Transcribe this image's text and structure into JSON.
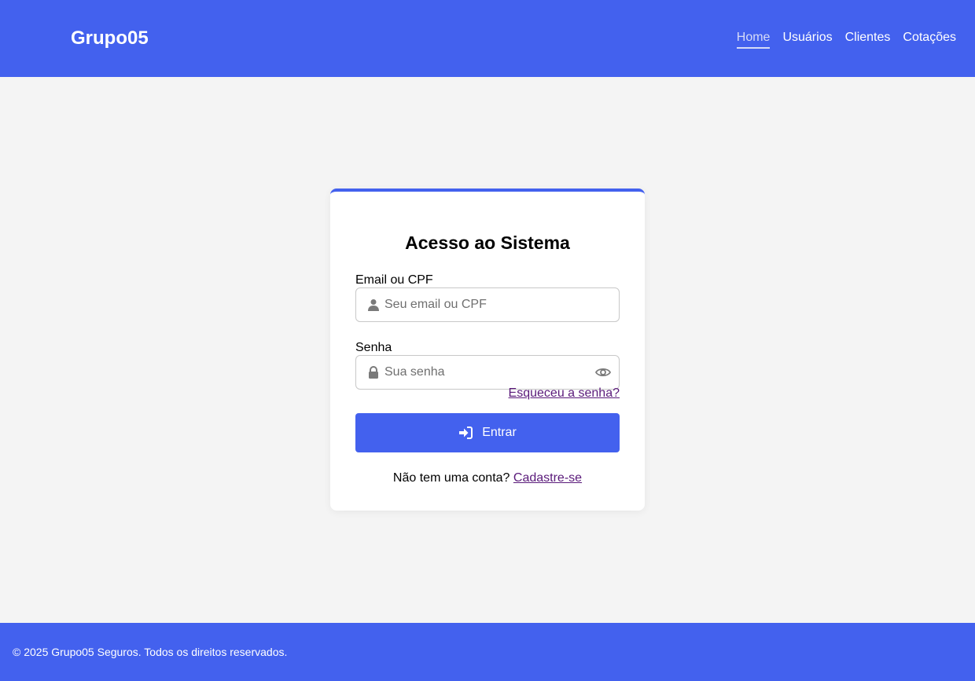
{
  "header": {
    "brand": "Grupo05",
    "nav": [
      {
        "label": "Home",
        "active": true
      },
      {
        "label": "Usuários",
        "active": false
      },
      {
        "label": "Clientes",
        "active": false
      },
      {
        "label": "Cotações",
        "active": false
      }
    ]
  },
  "login": {
    "title": "Acesso ao Sistema",
    "email_label": "Email ou CPF",
    "email_placeholder": "Seu email ou CPF",
    "email_value": "",
    "email_icon": "user-icon",
    "password_label": "Senha",
    "password_placeholder": "Sua senha",
    "password_value": "",
    "password_icon": "lock-icon",
    "toggle_icon": "eye-icon",
    "forgot_link": "Esqueceu a senha?",
    "submit_label": "Entrar",
    "submit_icon": "sign-in-icon",
    "signup_prompt": "Não tem uma conta?",
    "signup_link": "Cadastre-se"
  },
  "footer": {
    "text": "© 2025 Grupo05 Seguros. Todos os direitos reservados."
  },
  "colors": {
    "primary": "#4361ee",
    "background": "#f4f4f4",
    "link": "#5a1a7a"
  }
}
